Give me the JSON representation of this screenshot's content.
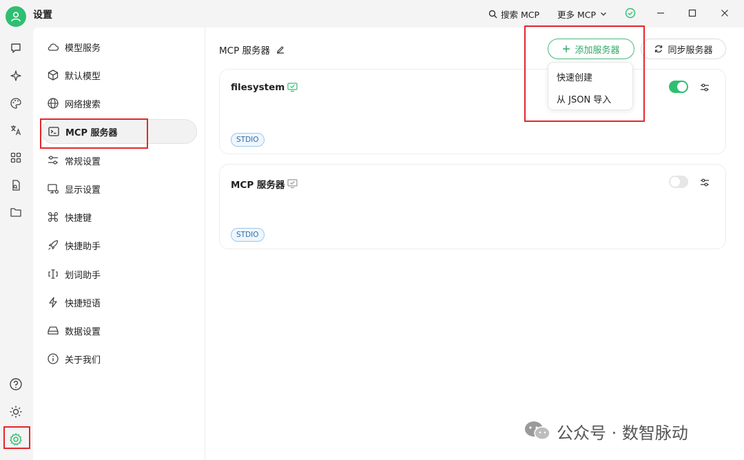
{
  "window": {
    "title": "设置",
    "search_label": "搜索 MCP",
    "more_label": "更多 MCP"
  },
  "sidebar_icons": [
    "chat-icon",
    "sparkle-icon",
    "palette-icon",
    "translate-icon",
    "apps-icon",
    "files-icon",
    "folder-icon",
    "help-icon",
    "brightness-icon",
    "settings-icon"
  ],
  "settings_nav": {
    "items": [
      {
        "label": "模型服务"
      },
      {
        "label": "默认模型"
      },
      {
        "label": "网络搜索"
      },
      {
        "label": "MCP 服务器"
      },
      {
        "label": "常规设置"
      },
      {
        "label": "显示设置"
      },
      {
        "label": "快捷键"
      },
      {
        "label": "快捷助手"
      },
      {
        "label": "划词助手"
      },
      {
        "label": "快捷短语"
      },
      {
        "label": "数据设置"
      },
      {
        "label": "关于我们"
      }
    ],
    "active_index": 3
  },
  "main": {
    "title": "MCP 服务器",
    "add_label": "添加服务器",
    "sync_label": "同步服务器",
    "add_menu": [
      "快速创建",
      "从 JSON 导入"
    ],
    "servers": [
      {
        "name": "filesystem",
        "tag": "STDIO",
        "enabled": true
      },
      {
        "name": "MCP 服务器",
        "tag": "STDIO",
        "enabled": false
      }
    ]
  },
  "watermark": {
    "text": "公众号 · 数智脉动"
  },
  "colors": {
    "accent": "#2fbf71",
    "highlight": "#e3262b",
    "tag_border": "#9cc7ea",
    "toggle_off": "#e6e6e6"
  }
}
